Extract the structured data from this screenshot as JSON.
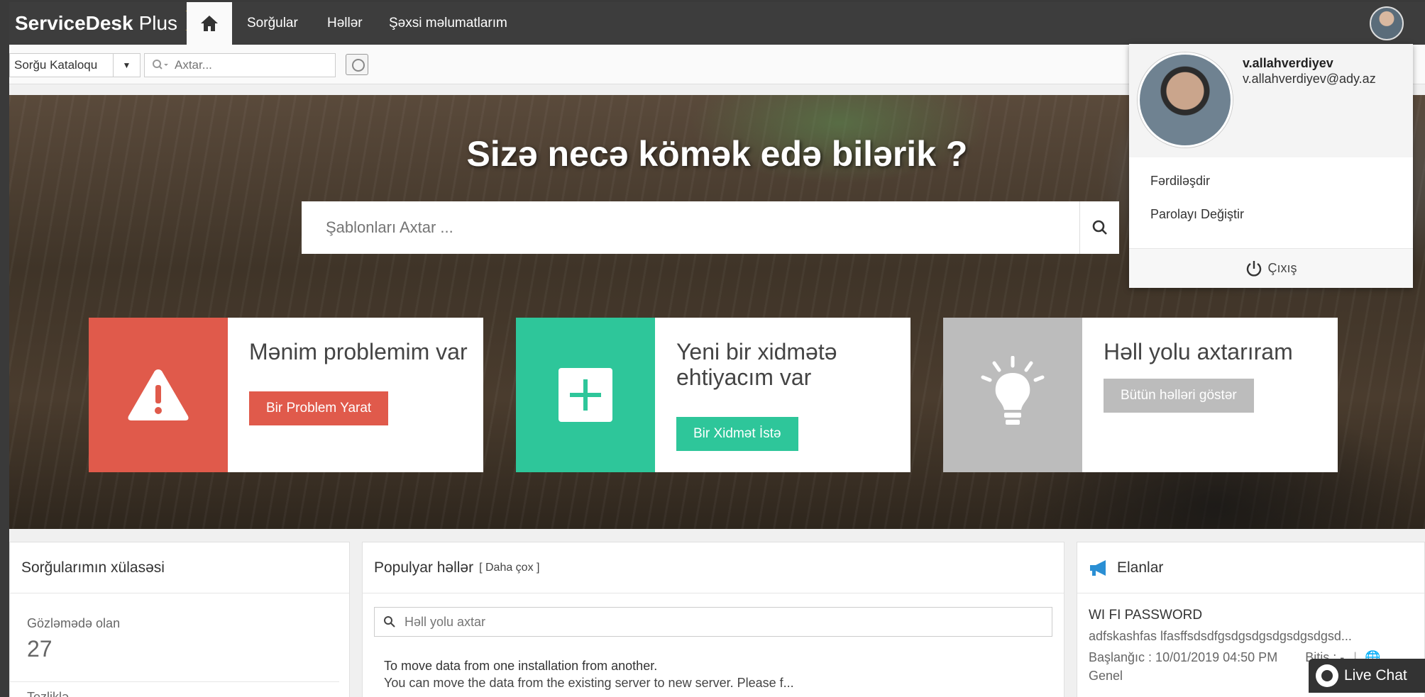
{
  "brand": {
    "name_bold": "ServiceDesk",
    "name_light": "Plus"
  },
  "nav": {
    "home_icon": "home-icon",
    "items": [
      {
        "label": "Sorğular"
      },
      {
        "label": "Həllər"
      },
      {
        "label": "Şəxsi məlumatlarım"
      }
    ]
  },
  "toolbar": {
    "catalog_label": "Sorğu Kataloqu",
    "search_placeholder": "Axtar..."
  },
  "hero": {
    "title": "Sizə necə kömək edə bilərik ?",
    "search_placeholder": "Şablonları Axtar ..."
  },
  "cards": [
    {
      "title": "Mənim problemim var",
      "button": "Bir Problem Yarat",
      "color": "#e05a4b"
    },
    {
      "title": "Yeni bir xidmətə ehtiyacım var",
      "button": "Bir Xidmət İstə",
      "color": "#2ec69a"
    },
    {
      "title": "Həll yolu axtarıram",
      "button": "Bütün həlləri göstər",
      "color": "#bcbcbc"
    }
  ],
  "summary": {
    "title": "Sorğularımın xülasəsi",
    "pending_label": "Gözləmədə olan",
    "pending_count": "27",
    "next_label": "Tezliklə ..."
  },
  "popular": {
    "title": "Populyar həllər",
    "more": "[ Daha çox ]",
    "search_placeholder": "Həll yolu axtar",
    "line1": "To move data from one installation from another.",
    "line2": "You can move the data from the existing server to new server. Please f..."
  },
  "announcements": {
    "title": "Elanlar",
    "item_title": "WI FI PASSWORD",
    "item_desc": "adfskashfas lfasffsdsdfgsdgsdgsdgsdgsdgsd...",
    "item_start": "Başlanğıc : 10/01/2019 04:50 PM",
    "item_end": "Bitiş : -",
    "item_category": "Genel"
  },
  "profile": {
    "username": "v.allahverdiyev",
    "email": "v.allahverdiyev@ady.az",
    "menu": [
      "Fərdiləşdir",
      "Parolayı Değiştir"
    ],
    "logout": "Çıxış"
  },
  "livechat": {
    "label": "Live Chat"
  }
}
